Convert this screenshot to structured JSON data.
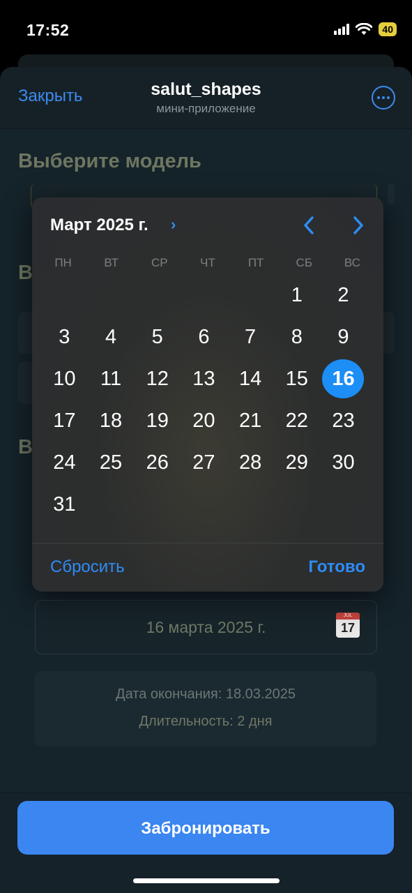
{
  "status_bar": {
    "time": "17:52",
    "battery": "40"
  },
  "header": {
    "close_label": "Закрыть",
    "title": "salut_shapes",
    "subtitle": "мини-приложение"
  },
  "main": {
    "section_title": "Выберите модель",
    "partial_letter_1": "В",
    "partial_letter_2": "В",
    "date_field_value": "16 марта 2025 г.",
    "date_icon_month": "JUL",
    "date_icon_day": "17",
    "end_date_line": "Дата окончания: 18.03.2025",
    "duration_line": "Длительность: 2 дня"
  },
  "calendar": {
    "month_label": "Март 2025 г.",
    "weekdays": [
      "ПН",
      "ВТ",
      "СР",
      "ЧТ",
      "ПТ",
      "СБ",
      "ВС"
    ],
    "leading_blanks": 5,
    "days": [
      "1",
      "2",
      "3",
      "4",
      "5",
      "6",
      "7",
      "8",
      "9",
      "10",
      "11",
      "12",
      "13",
      "14",
      "15",
      "16",
      "17",
      "18",
      "19",
      "20",
      "21",
      "22",
      "23",
      "24",
      "25",
      "26",
      "27",
      "28",
      "29",
      "30",
      "31"
    ],
    "selected_day": "16",
    "reset_label": "Сбросить",
    "done_label": "Готово"
  },
  "footer": {
    "book_label": "Забронировать"
  },
  "colors": {
    "accent": "#3b86f0",
    "selected": "#1c8ef6"
  }
}
